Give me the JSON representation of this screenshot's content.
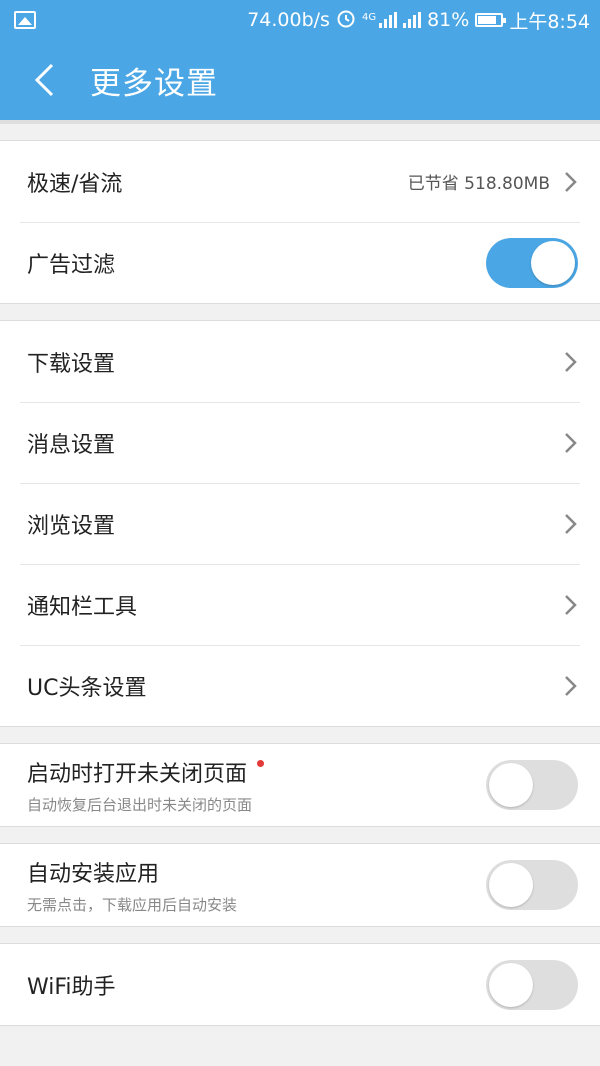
{
  "status_bar": {
    "speed": "74.00b/s",
    "network": "4G",
    "battery": "81%",
    "battery_level": 0.81,
    "time": "上午8:54"
  },
  "header": {
    "title": "更多设置"
  },
  "groups": [
    {
      "rows": [
        {
          "label": "极速/省流",
          "value": "已节省 518.80MB",
          "type": "chevron"
        },
        {
          "label": "广告过滤",
          "type": "toggle",
          "on": true
        }
      ]
    },
    {
      "rows": [
        {
          "label": "下载设置",
          "type": "chevron"
        },
        {
          "label": "消息设置",
          "type": "chevron"
        },
        {
          "label": "浏览设置",
          "type": "chevron"
        },
        {
          "label": "通知栏工具",
          "type": "chevron"
        },
        {
          "label": "UC头条设置",
          "type": "chevron"
        }
      ]
    },
    {
      "rows": [
        {
          "label": "启动时打开未关闭页面",
          "subtitle": "自动恢复后台退出时未关闭的页面",
          "type": "toggle",
          "on": false,
          "new_badge": true
        }
      ]
    },
    {
      "rows": [
        {
          "label": "自动安装应用",
          "subtitle": "无需点击，下载应用后自动安装",
          "type": "toggle",
          "on": false
        }
      ]
    },
    {
      "rows": [
        {
          "label": "WiFi助手",
          "type": "toggle",
          "on": false
        }
      ]
    }
  ],
  "colors": {
    "primary": "#4aa6e4",
    "badge_red": "#e53a3a",
    "toggle_off": "#dedede"
  }
}
